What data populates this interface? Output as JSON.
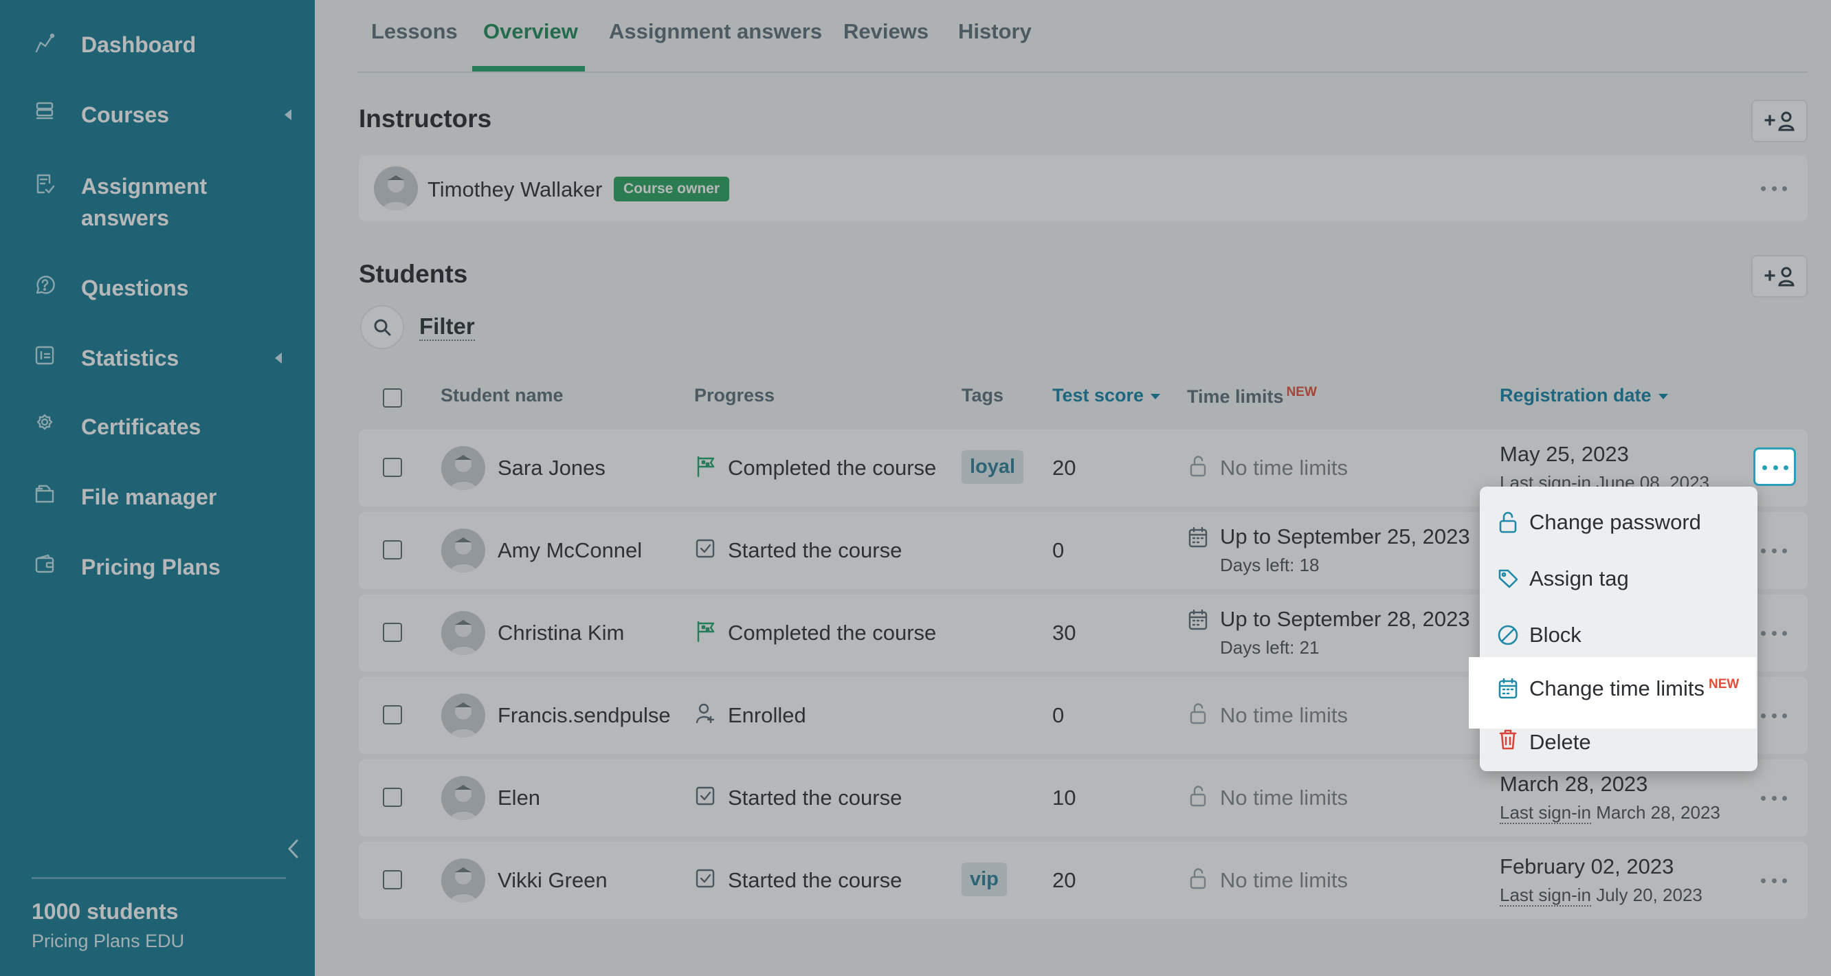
{
  "sidebar": {
    "items": [
      {
        "label": "Dashboard",
        "icon": "chart-line-icon"
      },
      {
        "label": "Courses",
        "icon": "courses-stack-icon",
        "has_submenu": true
      },
      {
        "label": "Assignment answers",
        "icon": "assignment-icon"
      },
      {
        "label": "Questions",
        "icon": "question-bubble-icon"
      },
      {
        "label": "Statistics",
        "icon": "statistics-icon",
        "has_submenu": true
      },
      {
        "label": "Certificates",
        "icon": "certificate-icon"
      },
      {
        "label": "File manager",
        "icon": "file-manager-icon"
      },
      {
        "label": "Pricing Plans",
        "icon": "wallet-icon"
      }
    ],
    "students_count": "1000 students",
    "plan": "Pricing Plans EDU"
  },
  "tabs": [
    "Lessons",
    "Overview",
    "Assignment answers",
    "Reviews",
    "History"
  ],
  "active_tab": "Overview",
  "instructors": {
    "title": "Instructors",
    "add_icon_text": "+",
    "name": "Timothey Wallaker",
    "badge": "Course owner"
  },
  "students": {
    "title": "Students",
    "add_icon_text": "+",
    "filter_label": "Filter",
    "columns": {
      "name": "Student name",
      "progress": "Progress",
      "tags": "Tags",
      "score": "Test score",
      "time_limits": "Time limits",
      "time_limits_new": "NEW",
      "registration": "Registration date"
    },
    "rows": [
      {
        "name": "Sara Jones",
        "progress": "Completed the course",
        "progress_icon": "flag-icon",
        "tag": "loyal",
        "score": "20",
        "time_limit": "No time limits",
        "time_icon": "unlock-icon",
        "reg_date": "May 25, 2023",
        "sign_in_label": "Last sign-in",
        "sign_in_date": "June 08, 2023"
      },
      {
        "name": "Amy McConnel",
        "progress": "Started the course",
        "progress_icon": "checkbox-icon",
        "tag": "",
        "score": "0",
        "time_limit": "Up to September 25, 2023",
        "days_left": "Days left: 18",
        "time_icon": "calendar-icon"
      },
      {
        "name": "Christina Kim",
        "progress": "Completed the course",
        "progress_icon": "flag-icon",
        "tag": "",
        "score": "30",
        "time_limit": "Up to September 28, 2023",
        "days_left": "Days left: 21",
        "time_icon": "calendar-icon"
      },
      {
        "name": "Francis.sendpulse",
        "progress": "Enrolled",
        "progress_icon": "user-enrolled-icon",
        "tag": "",
        "score": "0",
        "time_limit": "No time limits",
        "time_icon": "unlock-icon"
      },
      {
        "name": "Elen",
        "progress": "Started the course",
        "progress_icon": "checkbox-icon",
        "tag": "",
        "score": "10",
        "time_limit": "No time limits",
        "time_icon": "unlock-icon",
        "reg_date": "March 28, 2023",
        "sign_in_label": "Last sign-in",
        "sign_in_date": "March 28, 2023"
      },
      {
        "name": "Vikki Green",
        "progress": "Started the course",
        "progress_icon": "checkbox-icon",
        "tag": "vip",
        "score": "20",
        "time_limit": "No time limits",
        "time_icon": "unlock-icon",
        "reg_date": "February 02, 2023",
        "sign_in_label": "Last sign-in",
        "sign_in_date": "July 20, 2023"
      }
    ]
  },
  "context_menu": {
    "items": [
      {
        "label": "Change password",
        "icon": "unlock-icon"
      },
      {
        "label": "Assign tag",
        "icon": "tag-icon"
      },
      {
        "label": "Block",
        "icon": "block-icon"
      },
      {
        "label": "Change time limits",
        "icon": "calendar-icon",
        "badge": "NEW"
      },
      {
        "label": "Delete",
        "icon": "trash-icon"
      }
    ]
  },
  "colors": {
    "sidebar": "#137a93",
    "accent_green": "#1fa36a",
    "link_blue": "#1280a6",
    "new_red": "#e24d3a",
    "delete_red": "#d8443a"
  }
}
